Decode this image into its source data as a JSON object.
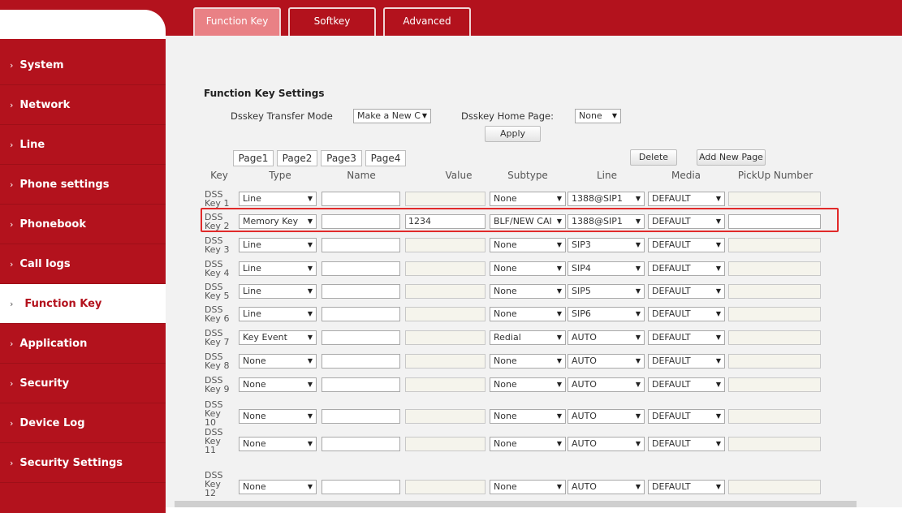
{
  "tabs": [
    "Function Key",
    "Softkey",
    "Advanced"
  ],
  "sidebar": [
    {
      "label": "System"
    },
    {
      "label": "Network"
    },
    {
      "label": "Line"
    },
    {
      "label": "Phone settings"
    },
    {
      "label": "Phonebook"
    },
    {
      "label": "Call logs"
    },
    {
      "label": "Function Key",
      "active": true
    },
    {
      "label": "Application"
    },
    {
      "label": "Security"
    },
    {
      "label": "Device Log"
    },
    {
      "label": "Security Settings"
    }
  ],
  "settings": {
    "title": "Function Key Settings",
    "transfer_mode_label": "Dsskey Transfer Mode",
    "transfer_mode_value": "Make a New C",
    "home_page_label": "Dsskey Home Page:",
    "home_page_value": "None",
    "apply_label": "Apply"
  },
  "pages": [
    "Page1",
    "Page2",
    "Page3",
    "Page4"
  ],
  "delete_label": "Delete",
  "add_page_label": "Add New Page",
  "columns": [
    "Key",
    "Type",
    "Name",
    "Value",
    "Subtype",
    "Line",
    "Media",
    "PickUp Number"
  ],
  "rows": [
    {
      "key": [
        "DSS",
        "Key 1"
      ],
      "type": "Line",
      "name": "",
      "value": "",
      "subtype": "None",
      "line": "1388@SIP1",
      "media": "DEFAULT",
      "pickup": ""
    },
    {
      "key": [
        "DSS",
        "Key 2"
      ],
      "type": "Memory Key",
      "name": "",
      "value": "1234",
      "subtype": "BLF/NEW CAI",
      "line": "1388@SIP1",
      "media": "DEFAULT",
      "pickup": ""
    },
    {
      "key": [
        "DSS",
        "Key 3"
      ],
      "type": "Line",
      "name": "",
      "value": "",
      "subtype": "None",
      "line": "SIP3",
      "media": "DEFAULT",
      "pickup": ""
    },
    {
      "key": [
        "DSS",
        "Key 4"
      ],
      "type": "Line",
      "name": "",
      "value": "",
      "subtype": "None",
      "line": "SIP4",
      "media": "DEFAULT",
      "pickup": ""
    },
    {
      "key": [
        "DSS",
        "Key 5"
      ],
      "type": "Line",
      "name": "",
      "value": "",
      "subtype": "None",
      "line": "SIP5",
      "media": "DEFAULT",
      "pickup": ""
    },
    {
      "key": [
        "DSS",
        "Key 6"
      ],
      "type": "Line",
      "name": "",
      "value": "",
      "subtype": "None",
      "line": "SIP6",
      "media": "DEFAULT",
      "pickup": ""
    },
    {
      "key": [
        "DSS",
        "Key 7"
      ],
      "type": "Key Event",
      "name": "",
      "value": "",
      "subtype": "Redial",
      "line": "AUTO",
      "media": "DEFAULT",
      "pickup": ""
    },
    {
      "key": [
        "DSS",
        "Key 8"
      ],
      "type": "None",
      "name": "",
      "value": "",
      "subtype": "None",
      "line": "AUTO",
      "media": "DEFAULT",
      "pickup": ""
    },
    {
      "key": [
        "DSS",
        "Key 9"
      ],
      "type": "None",
      "name": "",
      "value": "",
      "subtype": "None",
      "line": "AUTO",
      "media": "DEFAULT",
      "pickup": ""
    },
    {
      "key": [
        "DSS",
        "Key",
        "10"
      ],
      "type": "None",
      "name": "",
      "value": "",
      "subtype": "None",
      "line": "AUTO",
      "media": "DEFAULT",
      "pickup": ""
    },
    {
      "key": [
        "DSS",
        "Key",
        "11"
      ],
      "type": "None",
      "name": "",
      "value": "",
      "subtype": "None",
      "line": "AUTO",
      "media": "DEFAULT",
      "pickup": ""
    },
    {
      "key": [
        "DSS",
        "Key",
        "12"
      ],
      "type": "None",
      "name": "",
      "value": "",
      "subtype": "None",
      "line": "AUTO",
      "media": "DEFAULT",
      "pickup": ""
    }
  ],
  "colors": {
    "brand_red": "#b3121d",
    "active_tab": "#e98185",
    "highlight": "#e12a2a"
  }
}
